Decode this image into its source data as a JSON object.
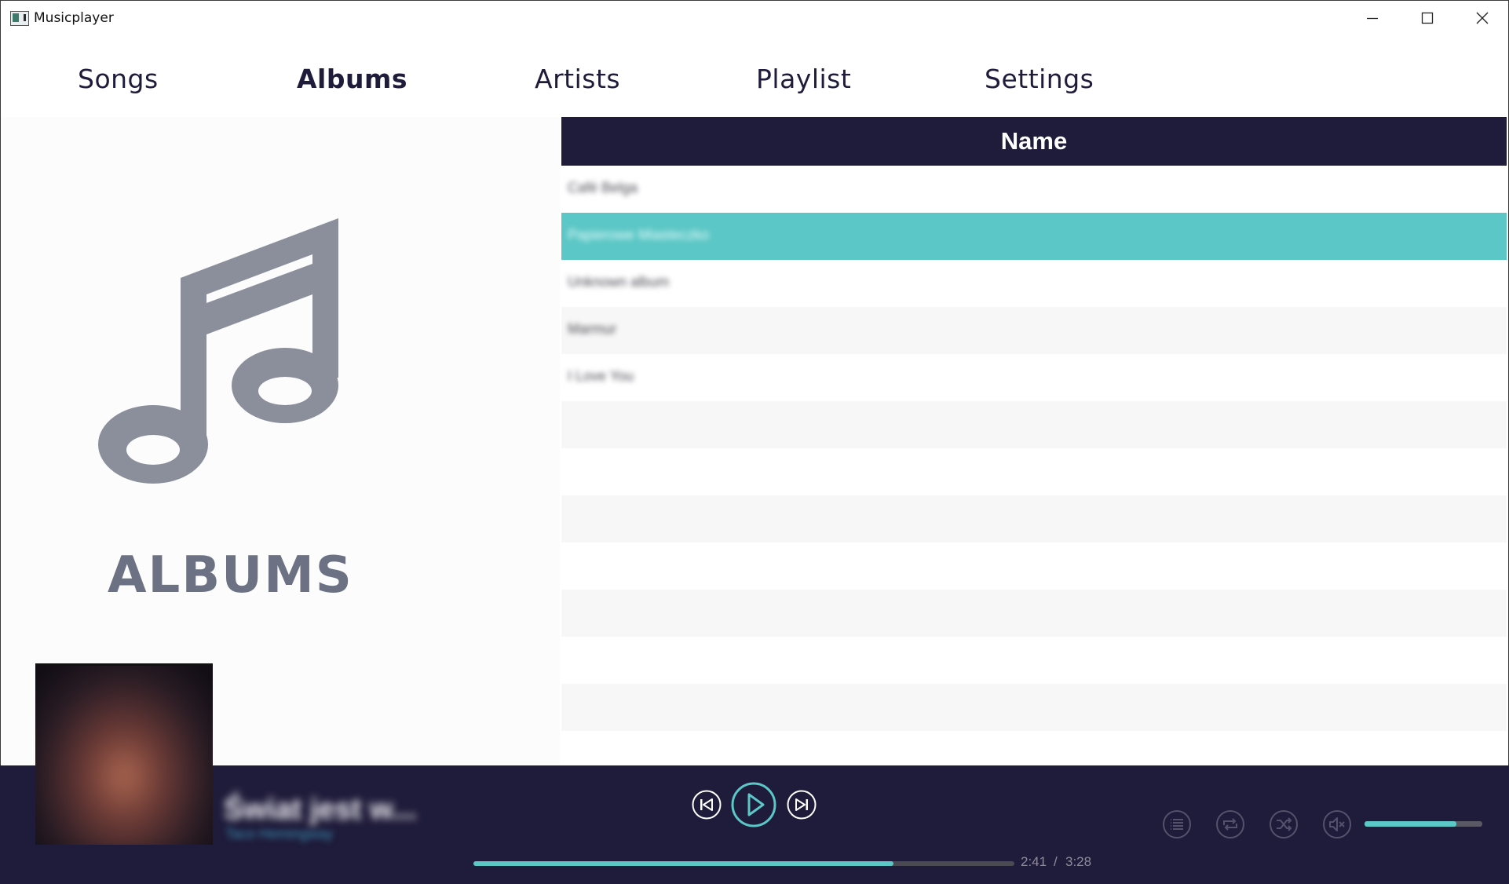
{
  "window": {
    "title": "Musicplayer"
  },
  "nav": {
    "items": [
      {
        "label": "Songs"
      },
      {
        "label": "Albums",
        "active": true
      },
      {
        "label": "Artists"
      },
      {
        "label": "Playlist"
      },
      {
        "label": "Settings"
      }
    ]
  },
  "left_panel": {
    "heading": "ALBUMS",
    "icon": "music-note-icon"
  },
  "table": {
    "column_header": "Name",
    "rows": [
      {
        "name": "Café Belga"
      },
      {
        "name": "Papierowe Miasteczko",
        "selected": true
      },
      {
        "name": "Unknown album"
      },
      {
        "name": "Marmur"
      },
      {
        "name": "I Love You"
      }
    ]
  },
  "player": {
    "track_title": "Świat jest w...",
    "track_artist": "Taco Hemingway",
    "elapsed": "2:41",
    "separator": "/",
    "duration": "3:28",
    "progress_fraction": 0.776,
    "volume_fraction": 0.78
  },
  "colors": {
    "accent": "#5bc7c6",
    "dark": "#1f1b3a",
    "icon_gray": "#8a8f9b"
  }
}
